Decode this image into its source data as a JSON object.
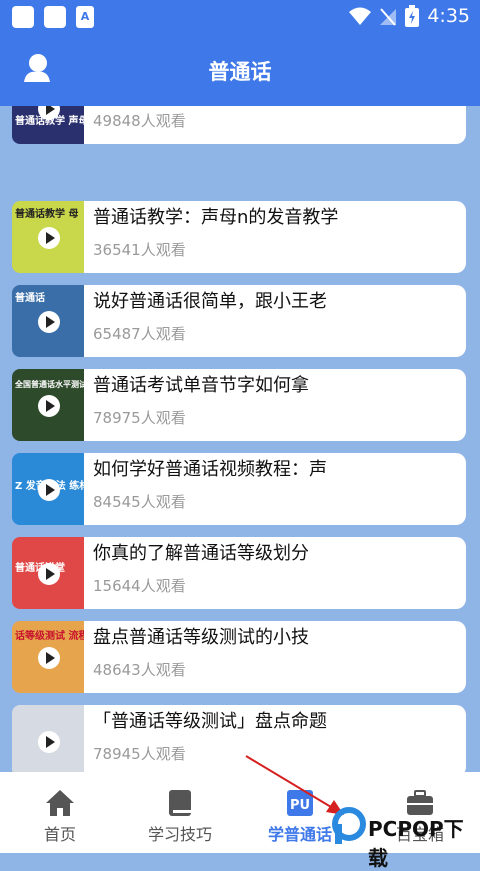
{
  "status_bar": {
    "time": "4:35",
    "app_badge": "A"
  },
  "app_bar": {
    "title": "普通话"
  },
  "videos": [
    {
      "title": "",
      "views": "49848人观看",
      "thumb_text": "普通话教学 声母",
      "thumb_color": "#2a2f6e"
    },
    {
      "title": "普通话教学：声母n的发音教学",
      "views": "36541人观看",
      "thumb_text": "普通话教学 母",
      "thumb_color": "#c8d84a"
    },
    {
      "title": "说好普通话很简单，跟小王老",
      "views": "65487人观看",
      "thumb_text": "普通话",
      "thumb_color": "#3a6ea8"
    },
    {
      "title": "普通话考试单音节字如何拿",
      "views": "78975人观看",
      "thumb_text": "全国普通话水平测试",
      "thumb_color": "#2d4a2a"
    },
    {
      "title": "如何学好普通话视频教程：声",
      "views": "84545人观看",
      "thumb_text": "Z 发音方法 练材料",
      "thumb_color": "#2b8ad8"
    },
    {
      "title": "你真的了解普通话等级划分",
      "views": "15644人观看",
      "thumb_text": "普通话讲堂",
      "thumb_color": "#e04848"
    },
    {
      "title": "盘点普通话等级测试的小技",
      "views": "48643人观看",
      "thumb_text": "话等级测试 流程",
      "thumb_color": "#e6a54c"
    },
    {
      "title": "「普通话等级测试」盘点命题",
      "views": "78945人观看",
      "thumb_text": "",
      "thumb_color": "#d6dae2"
    }
  ],
  "tabs": [
    {
      "label": "首页",
      "icon": "home-icon",
      "active": false
    },
    {
      "label": "学习技巧",
      "icon": "book-icon",
      "active": false
    },
    {
      "label": "学普通话",
      "icon": "pu-icon",
      "icon_text": "PU",
      "active": true
    },
    {
      "label": "百宝箱",
      "icon": "toolbox-icon",
      "active": false
    }
  ],
  "watermark": {
    "text": "PCPOP下载"
  },
  "colors": {
    "primary": "#3f78e8",
    "background": "#8fb4e6"
  }
}
